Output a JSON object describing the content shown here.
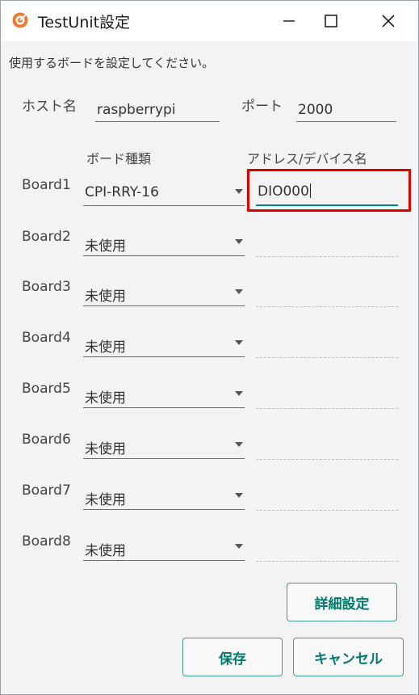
{
  "window": {
    "title": "TestUnit設定",
    "controls": {
      "minimize": "—",
      "maximize": "☐",
      "close": "✕"
    }
  },
  "instruction": "使用するボードを設定してください。",
  "host": {
    "label": "ホスト名",
    "value": "raspberrypi"
  },
  "port": {
    "label": "ポート",
    "value": "2000"
  },
  "columns": {
    "board_type": "ボード種類",
    "address": "アドレス/デバイス名"
  },
  "boards": [
    {
      "label": "Board1",
      "type": "CPI-RRY-16",
      "address": "DIO000"
    },
    {
      "label": "Board2",
      "type": "未使用",
      "address": ""
    },
    {
      "label": "Board3",
      "type": "未使用",
      "address": ""
    },
    {
      "label": "Board4",
      "type": "未使用",
      "address": ""
    },
    {
      "label": "Board5",
      "type": "未使用",
      "address": ""
    },
    {
      "label": "Board6",
      "type": "未使用",
      "address": ""
    },
    {
      "label": "Board7",
      "type": "未使用",
      "address": ""
    },
    {
      "label": "Board8",
      "type": "未使用",
      "address": ""
    }
  ],
  "buttons": {
    "details": "詳細設定",
    "save": "保存",
    "cancel": "キャンセル"
  },
  "colors": {
    "accent": "#00796b",
    "focus_underline": "#00897b",
    "highlight": "#e00000",
    "app_icon": "#f07a2b"
  },
  "icons": {
    "app": "app-target-icon",
    "dropdown": "chevron-down-icon"
  }
}
